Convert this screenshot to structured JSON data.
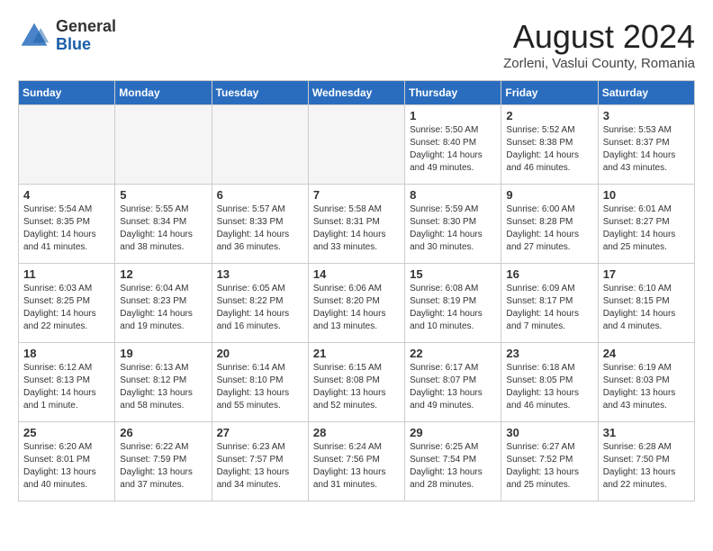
{
  "header": {
    "logo_general": "General",
    "logo_blue": "Blue",
    "month_title": "August 2024",
    "location": "Zorleni, Vaslui County, Romania"
  },
  "days_of_week": [
    "Sunday",
    "Monday",
    "Tuesday",
    "Wednesday",
    "Thursday",
    "Friday",
    "Saturday"
  ],
  "weeks": [
    [
      {
        "num": "",
        "info": "",
        "empty": true
      },
      {
        "num": "",
        "info": "",
        "empty": true
      },
      {
        "num": "",
        "info": "",
        "empty": true
      },
      {
        "num": "",
        "info": "",
        "empty": true
      },
      {
        "num": "1",
        "info": "Sunrise: 5:50 AM\nSunset: 8:40 PM\nDaylight: 14 hours\nand 49 minutes."
      },
      {
        "num": "2",
        "info": "Sunrise: 5:52 AM\nSunset: 8:38 PM\nDaylight: 14 hours\nand 46 minutes."
      },
      {
        "num": "3",
        "info": "Sunrise: 5:53 AM\nSunset: 8:37 PM\nDaylight: 14 hours\nand 43 minutes."
      }
    ],
    [
      {
        "num": "4",
        "info": "Sunrise: 5:54 AM\nSunset: 8:35 PM\nDaylight: 14 hours\nand 41 minutes."
      },
      {
        "num": "5",
        "info": "Sunrise: 5:55 AM\nSunset: 8:34 PM\nDaylight: 14 hours\nand 38 minutes."
      },
      {
        "num": "6",
        "info": "Sunrise: 5:57 AM\nSunset: 8:33 PM\nDaylight: 14 hours\nand 36 minutes."
      },
      {
        "num": "7",
        "info": "Sunrise: 5:58 AM\nSunset: 8:31 PM\nDaylight: 14 hours\nand 33 minutes."
      },
      {
        "num": "8",
        "info": "Sunrise: 5:59 AM\nSunset: 8:30 PM\nDaylight: 14 hours\nand 30 minutes."
      },
      {
        "num": "9",
        "info": "Sunrise: 6:00 AM\nSunset: 8:28 PM\nDaylight: 14 hours\nand 27 minutes."
      },
      {
        "num": "10",
        "info": "Sunrise: 6:01 AM\nSunset: 8:27 PM\nDaylight: 14 hours\nand 25 minutes."
      }
    ],
    [
      {
        "num": "11",
        "info": "Sunrise: 6:03 AM\nSunset: 8:25 PM\nDaylight: 14 hours\nand 22 minutes."
      },
      {
        "num": "12",
        "info": "Sunrise: 6:04 AM\nSunset: 8:23 PM\nDaylight: 14 hours\nand 19 minutes."
      },
      {
        "num": "13",
        "info": "Sunrise: 6:05 AM\nSunset: 8:22 PM\nDaylight: 14 hours\nand 16 minutes."
      },
      {
        "num": "14",
        "info": "Sunrise: 6:06 AM\nSunset: 8:20 PM\nDaylight: 14 hours\nand 13 minutes."
      },
      {
        "num": "15",
        "info": "Sunrise: 6:08 AM\nSunset: 8:19 PM\nDaylight: 14 hours\nand 10 minutes."
      },
      {
        "num": "16",
        "info": "Sunrise: 6:09 AM\nSunset: 8:17 PM\nDaylight: 14 hours\nand 7 minutes."
      },
      {
        "num": "17",
        "info": "Sunrise: 6:10 AM\nSunset: 8:15 PM\nDaylight: 14 hours\nand 4 minutes."
      }
    ],
    [
      {
        "num": "18",
        "info": "Sunrise: 6:12 AM\nSunset: 8:13 PM\nDaylight: 14 hours\nand 1 minute."
      },
      {
        "num": "19",
        "info": "Sunrise: 6:13 AM\nSunset: 8:12 PM\nDaylight: 13 hours\nand 58 minutes."
      },
      {
        "num": "20",
        "info": "Sunrise: 6:14 AM\nSunset: 8:10 PM\nDaylight: 13 hours\nand 55 minutes."
      },
      {
        "num": "21",
        "info": "Sunrise: 6:15 AM\nSunset: 8:08 PM\nDaylight: 13 hours\nand 52 minutes."
      },
      {
        "num": "22",
        "info": "Sunrise: 6:17 AM\nSunset: 8:07 PM\nDaylight: 13 hours\nand 49 minutes."
      },
      {
        "num": "23",
        "info": "Sunrise: 6:18 AM\nSunset: 8:05 PM\nDaylight: 13 hours\nand 46 minutes."
      },
      {
        "num": "24",
        "info": "Sunrise: 6:19 AM\nSunset: 8:03 PM\nDaylight: 13 hours\nand 43 minutes."
      }
    ],
    [
      {
        "num": "25",
        "info": "Sunrise: 6:20 AM\nSunset: 8:01 PM\nDaylight: 13 hours\nand 40 minutes."
      },
      {
        "num": "26",
        "info": "Sunrise: 6:22 AM\nSunset: 7:59 PM\nDaylight: 13 hours\nand 37 minutes."
      },
      {
        "num": "27",
        "info": "Sunrise: 6:23 AM\nSunset: 7:57 PM\nDaylight: 13 hours\nand 34 minutes."
      },
      {
        "num": "28",
        "info": "Sunrise: 6:24 AM\nSunset: 7:56 PM\nDaylight: 13 hours\nand 31 minutes."
      },
      {
        "num": "29",
        "info": "Sunrise: 6:25 AM\nSunset: 7:54 PM\nDaylight: 13 hours\nand 28 minutes."
      },
      {
        "num": "30",
        "info": "Sunrise: 6:27 AM\nSunset: 7:52 PM\nDaylight: 13 hours\nand 25 minutes."
      },
      {
        "num": "31",
        "info": "Sunrise: 6:28 AM\nSunset: 7:50 PM\nDaylight: 13 hours\nand 22 minutes."
      }
    ]
  ]
}
